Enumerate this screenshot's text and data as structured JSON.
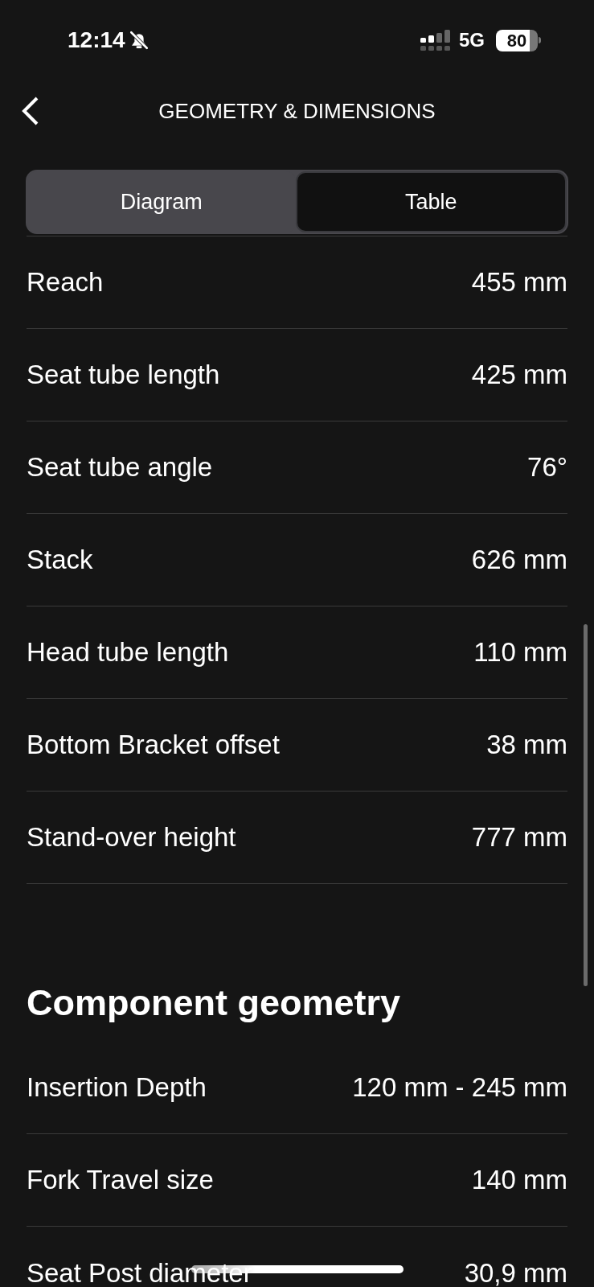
{
  "status_bar": {
    "time": "12:14",
    "network": "5G",
    "battery": "80"
  },
  "header": {
    "title": "GEOMETRY & DIMENSIONS"
  },
  "tabs": [
    {
      "label": "Diagram",
      "selected": false
    },
    {
      "label": "Table",
      "selected": true
    }
  ],
  "frame_geometry": [
    {
      "name": "Reach",
      "value": "455 mm"
    },
    {
      "name": "Seat tube length",
      "value": "425 mm"
    },
    {
      "name": "Seat tube angle",
      "value": "76°"
    },
    {
      "name": "Stack",
      "value": "626 mm"
    },
    {
      "name": "Head tube length",
      "value": "110 mm"
    },
    {
      "name": "Bottom Bracket offset",
      "value": "38 mm"
    },
    {
      "name": "Stand-over height",
      "value": "777 mm"
    }
  ],
  "component_geometry": {
    "title": "Component geometry",
    "rows": [
      {
        "name": "Insertion Depth",
        "value": "120 mm - 245 mm"
      },
      {
        "name": "Fork Travel size",
        "value": "140 mm"
      },
      {
        "name": "Seat Post diameter",
        "value": "30,9 mm"
      }
    ]
  }
}
